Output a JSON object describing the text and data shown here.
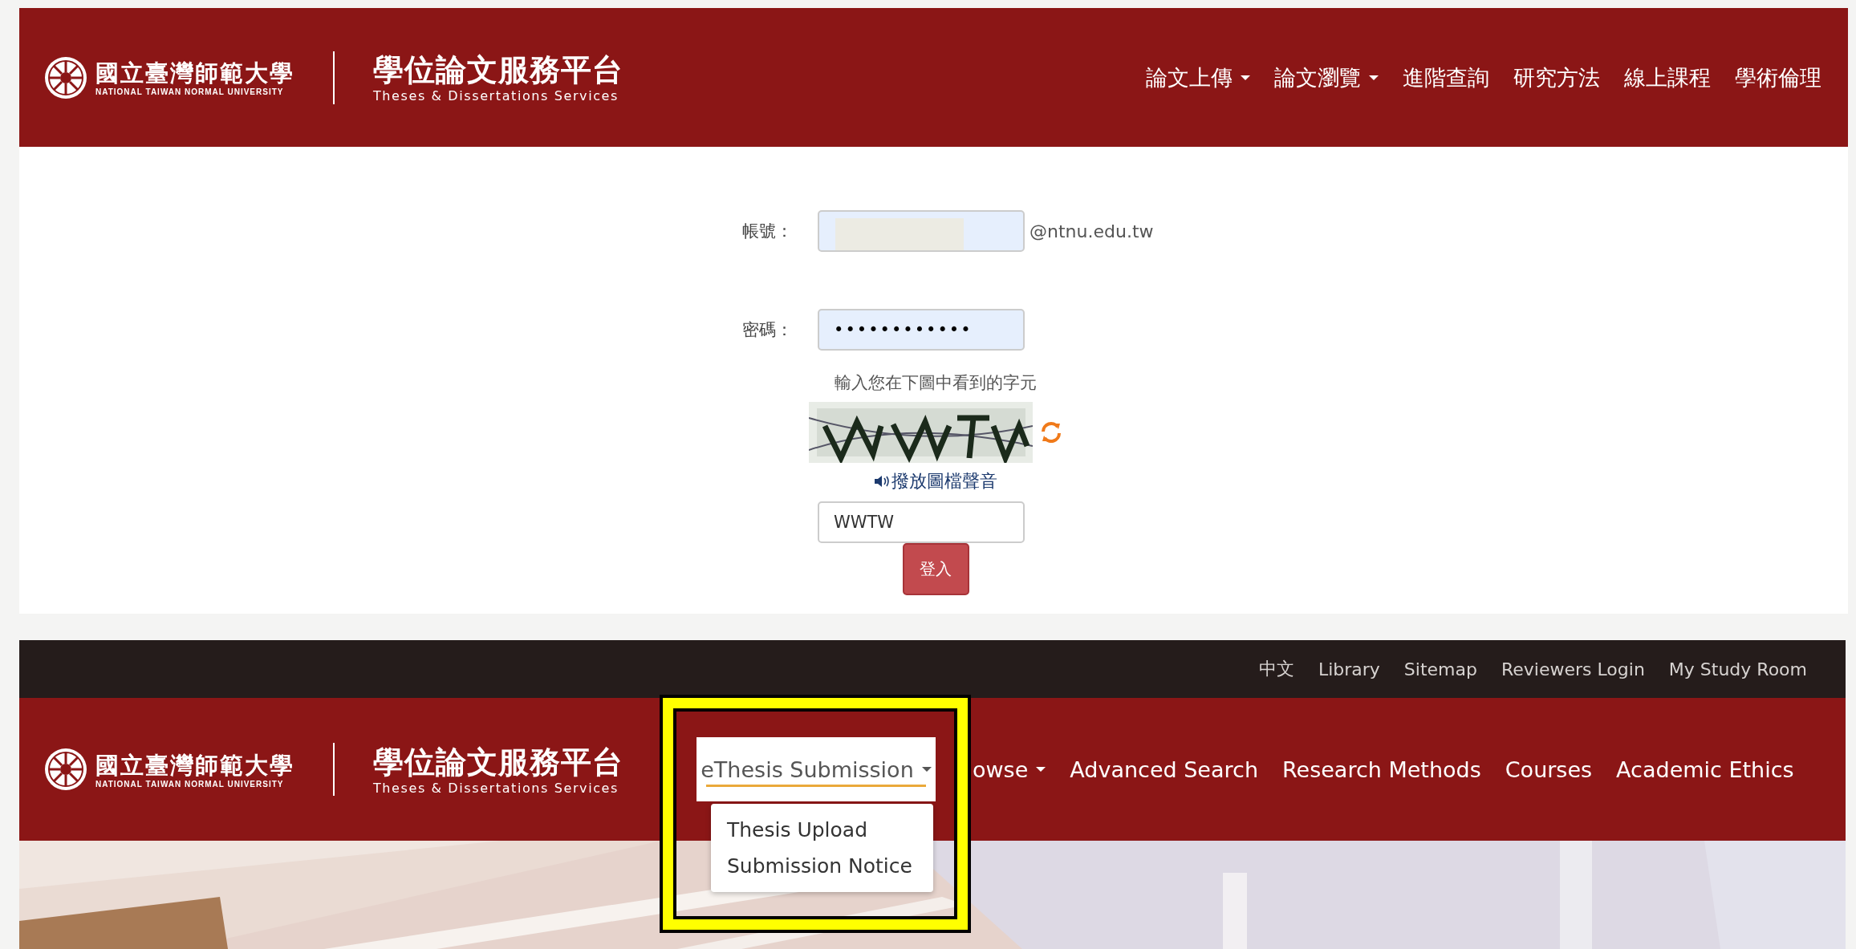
{
  "top_header": {
    "logo_chinese": "國立臺灣師範大學",
    "logo_english": "NATIONAL TAIWAN NORMAL UNIVERSITY",
    "title": "學位論文服務平台",
    "subtitle": "Theses & Dissertations Services",
    "nav": [
      {
        "label": "論文上傳",
        "dropdown": true
      },
      {
        "label": "論文瀏覽",
        "dropdown": true
      },
      {
        "label": "進階查詢",
        "dropdown": false
      },
      {
        "label": "研究方法",
        "dropdown": false
      },
      {
        "label": "線上課程",
        "dropdown": false
      },
      {
        "label": "學術倫理",
        "dropdown": false
      }
    ]
  },
  "login_form": {
    "account_label": "帳號：",
    "account_suffix": "@ntnu.edu.tw",
    "password_label": "密碼：",
    "password_value": "••••••••••••",
    "captcha_prompt": "輸入您在下圖中看到的字元",
    "audio_link": "撥放圖檔聲音",
    "captcha_value": "WWTW",
    "submit": "登入"
  },
  "bottom_header": {
    "utility_links": [
      "中文",
      "Library",
      "Sitemap",
      "Reviewers Login",
      "My Study Room"
    ],
    "logo_chinese": "國立臺灣師範大學",
    "logo_english": "NATIONAL TAIWAN NORMAL UNIVERSITY",
    "title": "學位論文服務平台",
    "subtitle": "Theses & Dissertations Services",
    "nav": [
      {
        "label": "eThesis Submission",
        "dropdown": true,
        "selected": true
      },
      {
        "label": "owse",
        "dropdown": true,
        "selected": false
      },
      {
        "label": "Advanced Search",
        "dropdown": false,
        "selected": false
      },
      {
        "label": "Research Methods",
        "dropdown": false,
        "selected": false
      },
      {
        "label": "Courses",
        "dropdown": false,
        "selected": false
      },
      {
        "label": "Academic Ethics",
        "dropdown": false,
        "selected": false
      }
    ],
    "dropdown_menu": [
      "Thesis Upload",
      "Submission Notice"
    ]
  }
}
